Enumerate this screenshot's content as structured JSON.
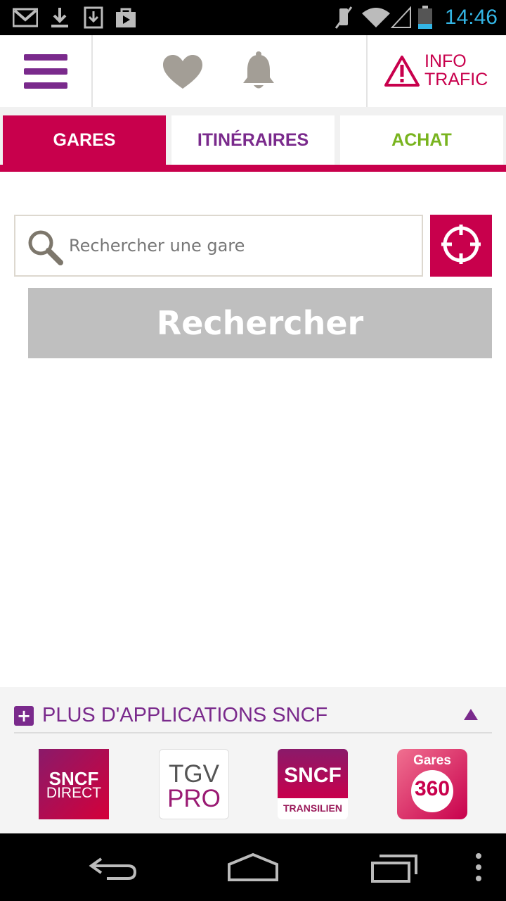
{
  "status_bar": {
    "time": "14:46",
    "icons": [
      "gmail-icon",
      "download-icon",
      "download-box-icon",
      "play-store-icon",
      "mute-icon",
      "wifi-icon",
      "signal-icon",
      "battery-icon"
    ]
  },
  "header": {
    "menu_icon": "hamburger-menu-icon",
    "favorites_icon": "heart-icon",
    "notifications_icon": "bell-icon",
    "info_trafic": {
      "line1": "INFO",
      "line2": "TRAFIC",
      "icon": "warning-icon"
    }
  },
  "tabs": [
    {
      "label": "GARES",
      "active": true
    },
    {
      "label": "ITINÉRAIRES",
      "active": false
    },
    {
      "label": "ACHAT",
      "active": false
    }
  ],
  "search": {
    "placeholder": "Rechercher une gare",
    "value": "",
    "locate_icon": "crosshair-icon",
    "button_label": "Rechercher"
  },
  "more_apps": {
    "title": "PLUS D'APPLICATIONS SNCF",
    "apps": [
      {
        "name": "sncf-direct",
        "line1": "SNCF",
        "line2": "DIRECT"
      },
      {
        "name": "tgv-pro",
        "line1": "TGV",
        "line2": "PRO"
      },
      {
        "name": "sncf-transilien",
        "line1": "SNCF",
        "line2": "TRANSILIEN"
      },
      {
        "name": "gares-360",
        "line1": "Gares",
        "line2": "360"
      }
    ]
  },
  "colors": {
    "brand_red": "#c8004c",
    "brand_purple": "#7a2a8c",
    "brand_green": "#79b41f",
    "button_disabled": "#bfbfbf",
    "status_time": "#33b5e5"
  }
}
